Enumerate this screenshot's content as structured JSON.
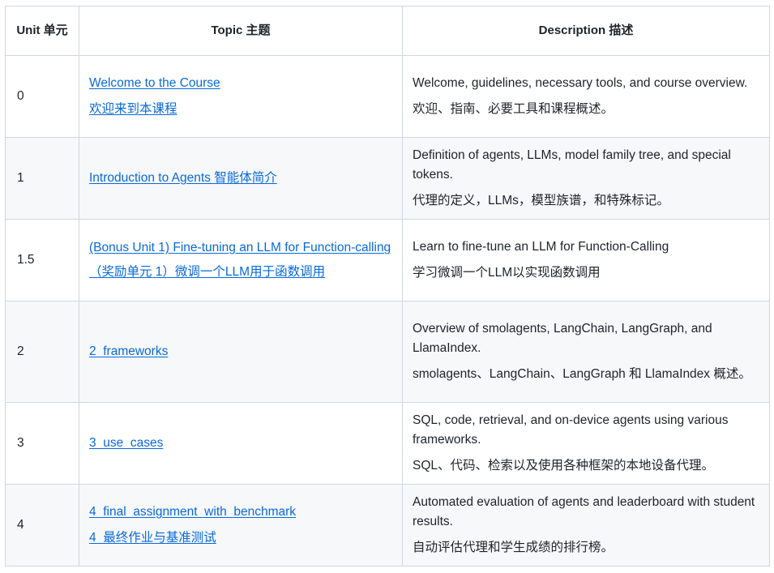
{
  "headers": {
    "unit": "Unit 单元",
    "topic": "Topic 主题",
    "description": "Description 描述"
  },
  "rows": [
    {
      "unit": "0",
      "topic_en": "Welcome to the Course",
      "topic_zh": "欢迎来到本课程",
      "desc_en": "Welcome, guidelines, necessary tools, and course overview.",
      "desc_zh": "欢迎、指南、必要工具和课程概述。"
    },
    {
      "unit": "1",
      "topic_en": "Introduction to Agents 智能体简介",
      "topic_zh": "",
      "desc_en": "Definition of agents, LLMs, model family tree, and special tokens.",
      "desc_zh": "代理的定义，LLMs，模型族谱，和特殊标记。"
    },
    {
      "unit": "1.5",
      "topic_en": "(Bonus Unit 1) Fine-tuning an LLM for Function-calling",
      "topic_zh": "（奖励单元 1）微调一个LLM用于函数调用",
      "desc_en": "Learn to fine-tune an LLM for Function-Calling",
      "desc_zh": "学习微调一个LLM以实现函数调用"
    },
    {
      "unit": "2",
      "topic_en": "2_frameworks",
      "topic_zh": "",
      "desc_en": "Overview of smolagents, LangChain, LangGraph, and LlamaIndex.",
      "desc_zh": "smolagents、LangChain、LangGraph 和 LlamaIndex 概述。"
    },
    {
      "unit": "3",
      "topic_en": "3_use_cases",
      "topic_zh": "",
      "desc_en": "SQL, code, retrieval, and on-device agents using various frameworks.",
      "desc_zh": "SQL、代码、检索以及使用各种框架的本地设备代理。"
    },
    {
      "unit": "4",
      "topic_en": "4_final_assignment_with_benchmark",
      "topic_zh": "4_最终作业与基准测试",
      "desc_en": "Automated evaluation of agents and leaderboard with student results.",
      "desc_zh": "自动评估代理和学生成绩的排行榜。"
    }
  ]
}
